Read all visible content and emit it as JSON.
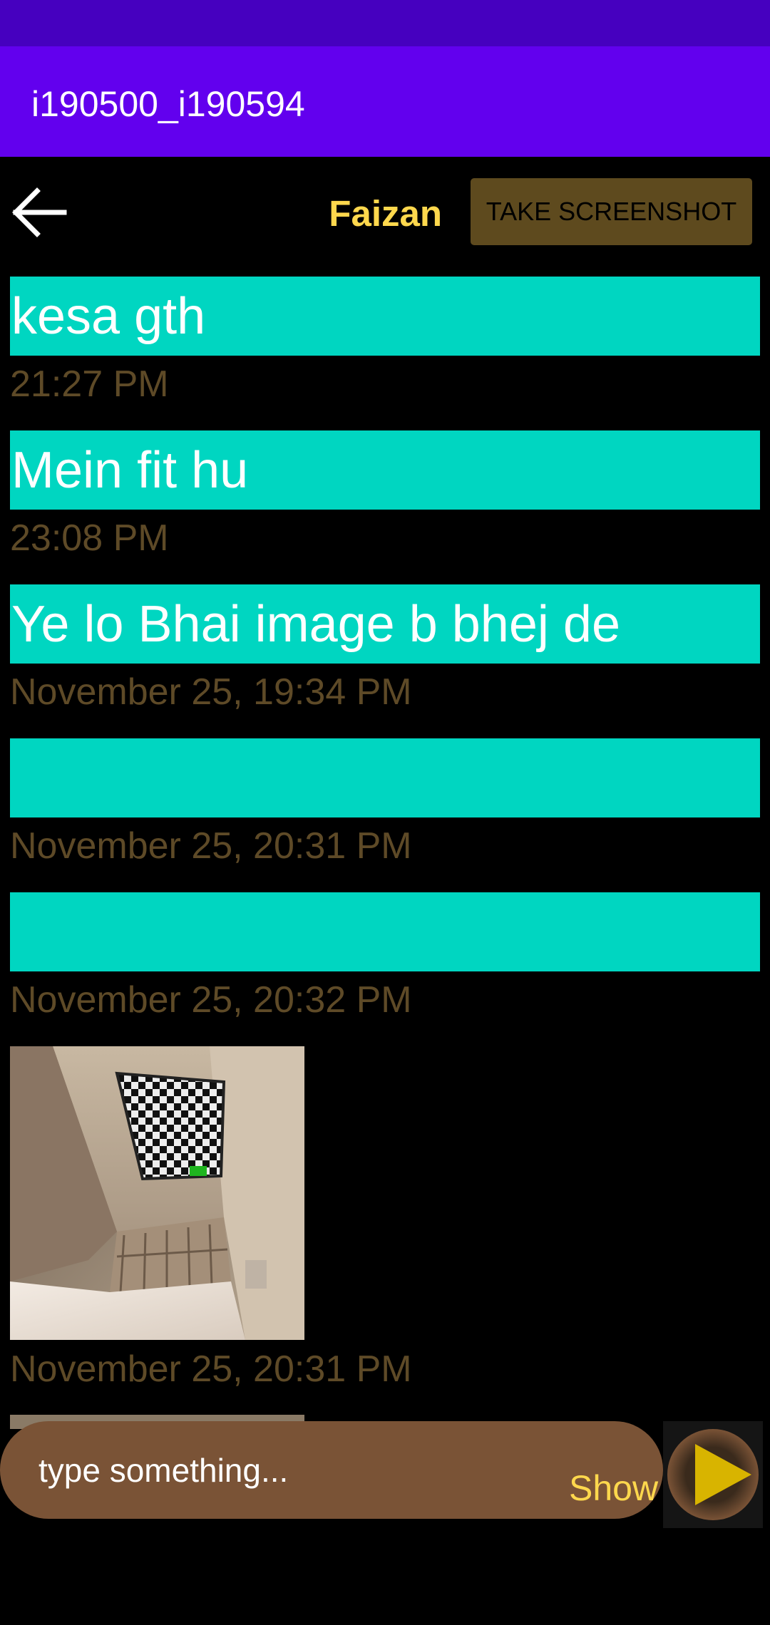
{
  "app_bar": {
    "title": "i190500_i190594"
  },
  "header": {
    "back_icon": "arrow-left-icon",
    "contact_name": "Faizan",
    "screenshot_label": "TAKE SCREENSHOT"
  },
  "messages": [
    {
      "text": "kesa gth",
      "time": "21:27 PM"
    },
    {
      "text": "Mein fit hu",
      "time": "23:08 PM"
    },
    {
      "text": "Ye lo Bhai image b bhej de",
      "time": "November 25, 19:34 PM"
    },
    {
      "text": "",
      "time": "November 25, 20:31 PM"
    },
    {
      "text": "",
      "time": "November 25, 20:32 PM"
    },
    {
      "type": "image",
      "time": "November 25, 20:31 PM"
    }
  ],
  "composer": {
    "placeholder": "type something...",
    "show_label": "Show",
    "send_icon": "play-send-icon"
  },
  "colors": {
    "status_bar": "#4600BF",
    "app_bar": "#6200EE",
    "bubble": "#00D6C1",
    "timestamp": "#5E4A27",
    "accent_yellow": "#FFD84D",
    "input_bg": "#7A5336"
  }
}
